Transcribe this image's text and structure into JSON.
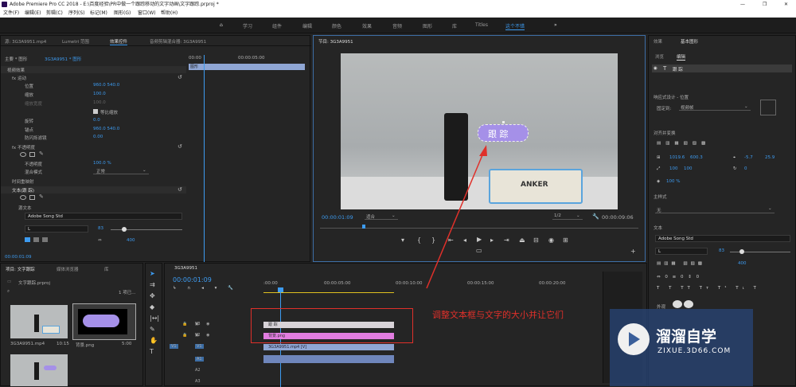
{
  "app": {
    "title": "Adobe Premiere Pro CC 2018 - E:\\百度经验\\PR中做一个跟踪移动的文字动画\\文字跟踪.prproj *"
  },
  "menu": [
    "文件(F)",
    "编辑(E)",
    "剪辑(C)",
    "序列(S)",
    "标记(M)",
    "图形(G)",
    "窗口(W)",
    "帮助(H)"
  ],
  "workspaces": [
    "学习",
    "组件",
    "编辑",
    "颜色",
    "效果",
    "音频",
    "图形",
    "库",
    "Titles",
    "这个不错"
  ],
  "source_panel": {
    "tabs": [
      "源: 3G3A9951.mp4",
      "Lumetri 范围",
      "效果控件",
      "音频剪辑混合器: 3G3A9951"
    ],
    "header": "主要 * 图形",
    "clip": "3G3A9951 * 图形",
    "timeruler": "00:00",
    "timeruler2": "00:00:05:00",
    "clip_label": "图形",
    "rows": [
      {
        "t": "视频效果"
      },
      {
        "t": "fx 运动"
      },
      {
        "t": "位置",
        "v": "960.0   540.0"
      },
      {
        "t": "缩放",
        "v": "100.0"
      },
      {
        "t": "缩放宽度",
        "v": "100.0"
      },
      {
        "t": "",
        "v": "等比缩放"
      },
      {
        "t": "旋转",
        "v": "0.0"
      },
      {
        "t": "锚点",
        "v": "960.0   540.0"
      },
      {
        "t": "防闪烁滤镜",
        "v": "0.00"
      },
      {
        "t": "fx 不透明度"
      },
      {
        "t": ""
      },
      {
        "t": "不透明度",
        "v": "100.0 %"
      },
      {
        "t": "混合模式",
        "v": "正常"
      },
      {
        "t": "时间重映射"
      },
      {
        "t": "文本(跟 踪)"
      },
      {
        "t": ""
      },
      {
        "t": "源文本"
      }
    ],
    "font": "Adobe Song Std",
    "style": "L",
    "size": "83",
    "tracking": "400",
    "time": "00:00:01:09"
  },
  "program_monitor": {
    "title": "节目: 3G3A9951",
    "timecode": "00:00:01:09",
    "fit": "适合",
    "quality": "1/2",
    "duration": "00:00:09:06",
    "overlay_text": "跟 踪",
    "product_text": "ANKER"
  },
  "project_panel": {
    "tabs": [
      "项目: 文字跟踪",
      "媒体浏览器",
      "库"
    ],
    "project_file": "文字跟踪.prproj",
    "count": "1 项已...",
    "items": [
      {
        "name": "3G3A9951.mp4",
        "dur": "10:15"
      },
      {
        "name": "背景.png",
        "dur": "5:00"
      }
    ]
  },
  "timeline": {
    "tab": "3G3A9951",
    "timecode": "00:00:01:09",
    "ruler": [
      ":00:00",
      "00:00:05:00",
      "00:00:10:00",
      "00:00:15:00",
      "00:00:20:00"
    ],
    "tracks": [
      "V3",
      "V2",
      "V1",
      "A1",
      "A2",
      "A3"
    ],
    "clips": [
      {
        "label": "跟 踪",
        "color": "#d8d3d8"
      },
      {
        "label": "背景.png",
        "color": "#e27de0"
      },
      {
        "label": "3G3A9951.mp4 [V]",
        "color": "#8fa6d4"
      },
      {
        "label": "",
        "color": "#6f86bc"
      }
    ]
  },
  "annotation": "调整文本框与文字的大小并让它们",
  "essential_graphics": {
    "tabs": [
      "效果",
      "基本图形"
    ],
    "subtabs": [
      "浏览",
      "编辑"
    ],
    "layer": "跟 踪",
    "align_label": "响应式设计 - 位置",
    "pin_label": "固定到:",
    "pin_value": "视频帧",
    "section": "对齐并变换",
    "pos": "1019.6",
    "pos2": "600.3",
    "rot": "-5.7",
    "rot2": "25.9",
    "scale": "100",
    "scale2": "100",
    "rotation": "0",
    "opacity": "100 %",
    "master_style": "主样式",
    "style_value": "无",
    "text_label": "文本",
    "font": "Adobe Song Std",
    "fstyle": "L",
    "fsize": "83",
    "tracking": "400",
    "appearance": "外观"
  },
  "watermark": {
    "cn": "溜溜自学",
    "en": "ZIXUE.3D66.COM"
  },
  "colors": {
    "accent": "#3d9bf0",
    "annotation": "#e0302a",
    "bubble": "#a590e8"
  }
}
